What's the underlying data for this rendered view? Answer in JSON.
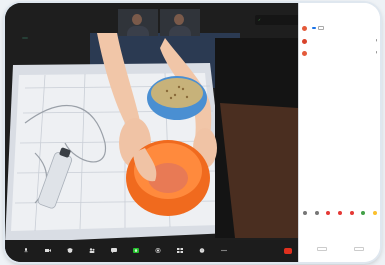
{
  "meeting": {
    "speaker_tag": "",
    "thumbnails": [
      {
        "label": ""
      },
      {
        "label": ""
      }
    ],
    "mini_menu": [
      {
        "label": "",
        "checked": true
      },
      {
        "label": "",
        "checked": false
      }
    ]
  },
  "toolbar": {
    "buttons": [
      {
        "icon": "microphone-icon",
        "label": ""
      },
      {
        "icon": "video-camera-icon",
        "label": ""
      },
      {
        "icon": "security-icon",
        "label": ""
      },
      {
        "icon": "participants-icon",
        "label": ""
      },
      {
        "icon": "chat-icon",
        "label": ""
      },
      {
        "icon": "share-screen-icon",
        "label": ""
      },
      {
        "icon": "record-icon",
        "label": ""
      },
      {
        "icon": "breakout-rooms-icon",
        "label": ""
      },
      {
        "icon": "reactions-icon",
        "label": ""
      },
      {
        "icon": "more-icon",
        "label": ""
      }
    ],
    "end_label": "",
    "colors": {
      "share": "#25c12e",
      "end": "#e0301e"
    }
  },
  "panel": {
    "title": "",
    "participants": [
      {
        "name": "",
        "avatar_color": "#e45a3a",
        "buttons": [
          "",
          ""
        ]
      },
      {
        "name": "",
        "avatar_color": "#d8432b",
        "buttons": []
      },
      {
        "name": "",
        "avatar_color": "#e45a3a",
        "buttons": []
      }
    ],
    "reactions": [
      {
        "color": "#777777",
        "label": ""
      },
      {
        "color": "#777777",
        "label": ""
      },
      {
        "color": "#e53935",
        "label": ""
      },
      {
        "color": "#e53935",
        "label": ""
      },
      {
        "color": "#e53935",
        "label": ""
      },
      {
        "color": "#43a047",
        "label": ""
      },
      {
        "color": "#fbc02d",
        "label": ""
      }
    ],
    "footer": [
      "",
      ""
    ]
  }
}
